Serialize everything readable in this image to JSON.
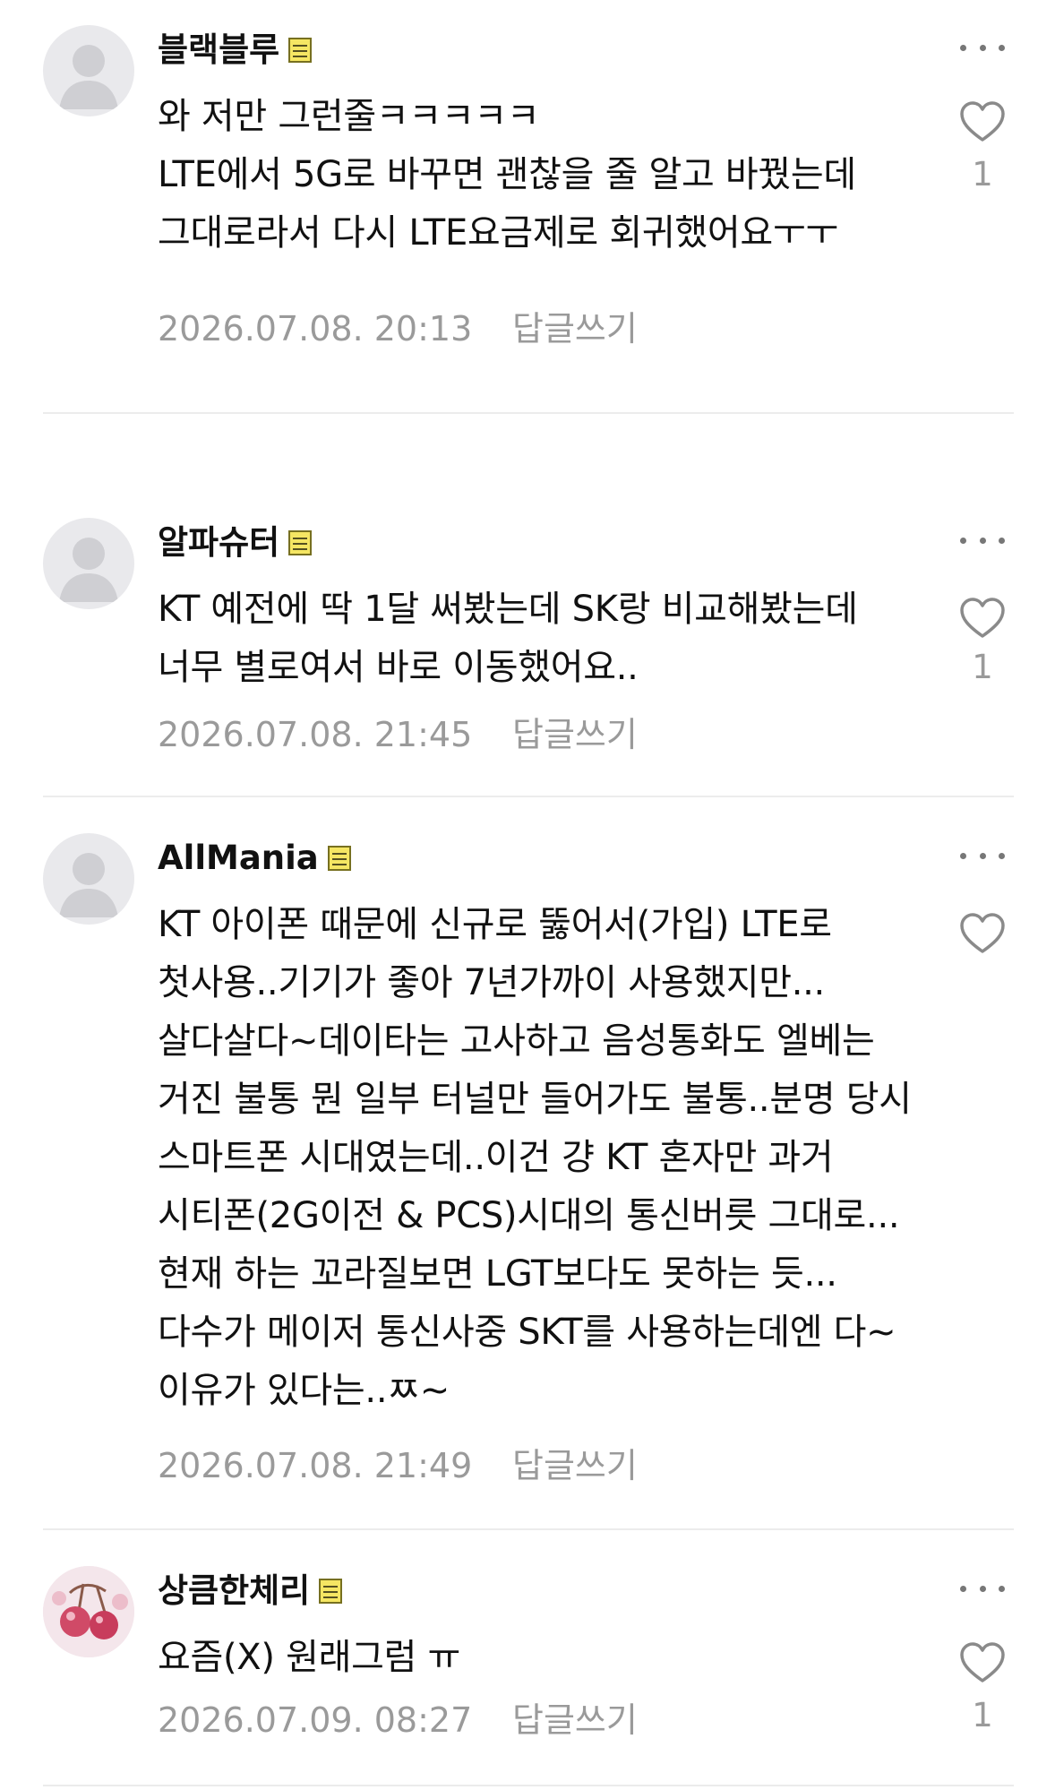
{
  "comments": [
    {
      "author": "블랙블루",
      "text": "와 저만 그런줄ㅋㅋㅋㅋㅋ\nLTE에서 5G로 바꾸면 괜찮을 줄 알고 바꿨는데\n그대로라서 다시 LTE요금제로 회귀했어요ㅜㅜ",
      "date": "2026.07.08. 20:13",
      "reply_label": "답글쓰기",
      "likes": "1",
      "avatar": "default-profile-icon"
    },
    {
      "author": "알파슈터",
      "text": "KT 예전에 딱 1달 써봤는데 SK랑 비교해봤는데 너무 별로여서 바로 이동했어요..",
      "date": "2026.07.08. 21:45",
      "reply_label": "답글쓰기",
      "likes": "1",
      "avatar": "default-profile-icon"
    },
    {
      "author": "AllMania",
      "text": "KT 아이폰 때문에 신규로 뚫어서(가입) LTE로 첫사용..기기가 좋아 7년가까이 사용했지만... 살다살다~데이타는 고사하고 음성통화도 엘베는 거진 불통 뭔 일부 터널만 들어가도 불통..분명 당시 스마트폰 시대였는데..이건 걍 KT 혼자만 과거 시티폰(2G이전 & PCS)시대의 통신버릇 그대로...현재 하는 꼬라질보면 LGT보다도 못하는 듯...다수가 메이저 통신사중 SKT를 사용하는데엔 다~이유가 있다는..ㅉ~",
      "date": "2026.07.08. 21:49",
      "reply_label": "답글쓰기",
      "likes": "",
      "avatar": "default-profile-icon"
    },
    {
      "author": "상큼한체리",
      "text": "요즘(X) 원래그럼 ㅠ",
      "date": "2026.07.09. 08:27",
      "reply_label": "답글쓰기",
      "likes": "1",
      "avatar": "cherry-profile-image"
    }
  ],
  "colors": {
    "text": "#111111",
    "meta": "#9a9a9a",
    "divider": "#ececec",
    "badge": "#f5e663"
  }
}
